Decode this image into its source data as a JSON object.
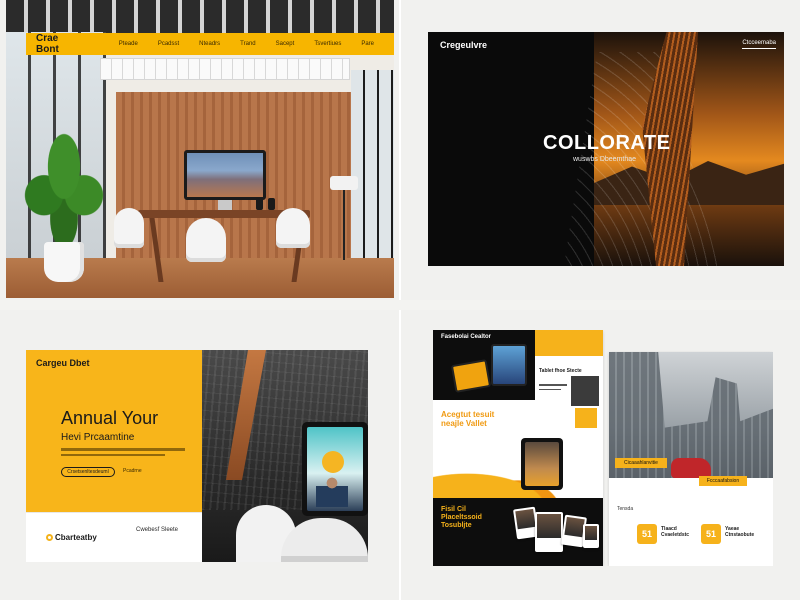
{
  "panel1": {
    "brand": "Crae Bont",
    "nav_items": [
      "Pteade",
      "Pcadsst",
      "Nteadrs",
      "Trand",
      "Sacept",
      "Tsvertiues",
      "Pare"
    ],
    "icons": [
      "square-icon",
      "phone-icon",
      "lock-icon"
    ]
  },
  "panel2": {
    "logo": "Cregeulvre",
    "corner_label": "Ctcceemaba",
    "title": "COLLORATE",
    "subtitle": "wuswbs Dbeemthae"
  },
  "panel3": {
    "brand": "Cargeu Dbet",
    "title": "Annual Your",
    "subtitle": "Hevi Prcaamtine",
    "button_label": "Crsetsenltesdeuml",
    "secondary_link": "Pcadrne",
    "footer_logo": "Cbarteatby",
    "footer_contact": "Cwebesf Sleete"
  },
  "panel4": {
    "top_title": "Fasebolai Cealtor",
    "white_panel_title": "Tablet fhoe Stecte",
    "headline": "Acegtut tesuit\nneajle Vallet",
    "bottom_title": "Fisil Cil\nPlaceltssoid\nTosubljte",
    "city_button": "Cicaaahlanvitie",
    "city_button2": "Fcccaafabsion",
    "small_label": "Tensda",
    "features": [
      {
        "icon": "51",
        "label": "Tlaacd\nCvaeletdstc"
      },
      {
        "icon": "51",
        "label": "Yaeae\nCtnstaobute"
      }
    ]
  },
  "colors": {
    "accent_yellow": "#f6b21b",
    "dark": "#0d0d0d"
  }
}
